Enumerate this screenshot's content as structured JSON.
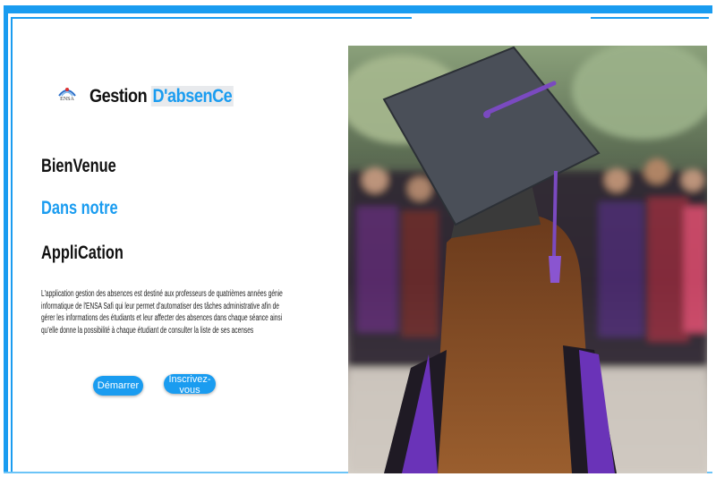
{
  "header": {
    "logo_text": "ENSA",
    "title_prefix": "Gestion",
    "title_highlight": "D'absenCe"
  },
  "hero": {
    "line1": "BienVenue",
    "line2": "Dans notre",
    "line3": "AppliCation",
    "description": "L'application gestion des absences est destiné aux professeurs de quatrièmes années génie informatique de l'ENSA Safi qui leur permet d'automatiser des tâches administrative afin de gérer les informations des étudiants et leur affecter des absences dans chaque séance ainsi qu'elle donne la possibilité à chaque étudiant de consulter la liste de ses acenses"
  },
  "buttons": {
    "start_label": "Démarrer",
    "signup_label": "Inscrivez-vous"
  },
  "colors": {
    "accent": "#1a9cf0",
    "text": "#111111"
  },
  "image": {
    "subject": "graduate-with-mortarboard-photo"
  }
}
